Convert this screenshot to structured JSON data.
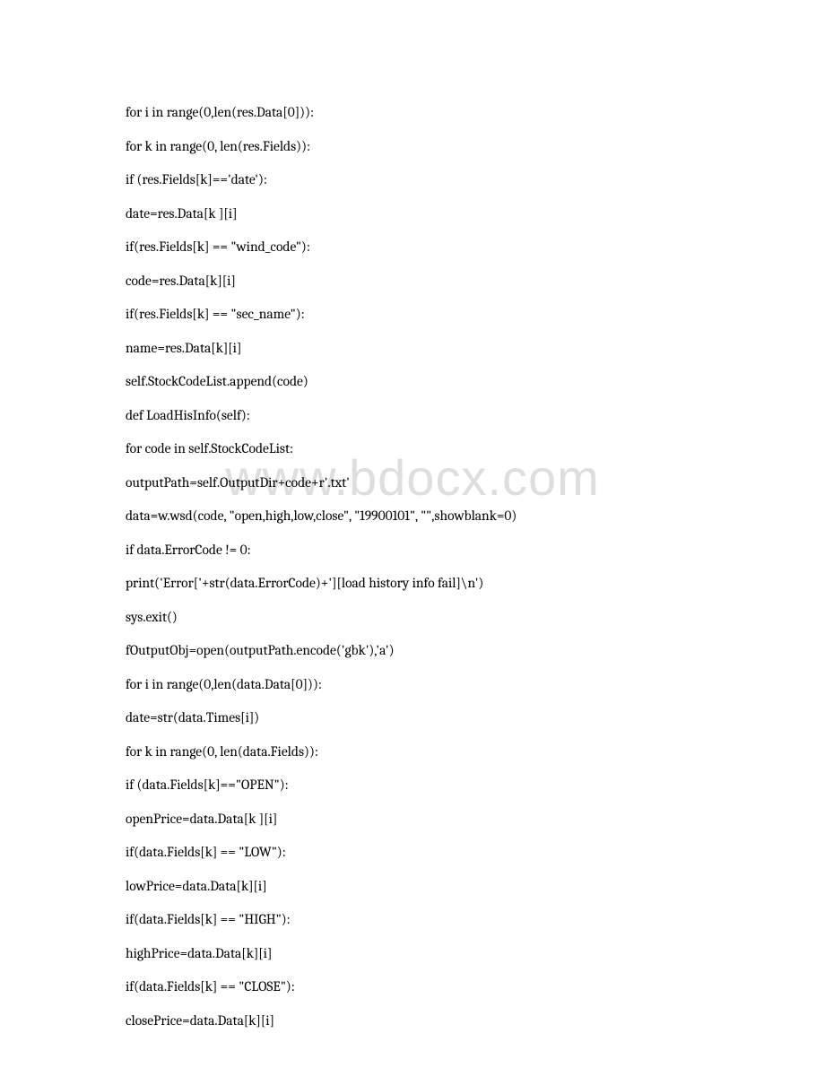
{
  "watermark": "www.bdocx.com",
  "code_lines": [
    "for i in range(0,len(res.Data[0])):",
    "for k in range(0, len(res.Fields)):",
    "if (res.Fields[k]=='date'):",
    "date=res.Data[k ][i]",
    "if(res.Fields[k] == \"wind_code\"):",
    "code=res.Data[k][i]",
    "if(res.Fields[k] == \"sec_name\"):",
    "name=res.Data[k][i]",
    "self.StockCodeList.append(code)",
    "def LoadHisInfo(self):",
    "for code in self.StockCodeList:",
    "outputPath=self.OutputDir+code+r'.txt'",
    "data=w.wsd(code, \"open,high,low,close\", \"19900101\", \"\",showblank=0)",
    "if data.ErrorCode != 0:",
    "print('Error['+str(data.ErrorCode)+'][load history info fail]\\n')",
    "sys.exit()",
    "fOutputObj=open(outputPath.encode('gbk'),'a')",
    "for i in range(0,len(data.Data[0])):",
    "date=str(data.Times[i])",
    "for k in range(0, len(data.Fields)):",
    "if (data.Fields[k]==\"OPEN\"):",
    "openPrice=data.Data[k ][i]",
    "if(data.Fields[k] == \"LOW\"):",
    "lowPrice=data.Data[k][i]",
    "if(data.Fields[k] == \"HIGH\"):",
    "highPrice=data.Data[k][i]",
    "if(data.Fields[k] == \"CLOSE\"):",
    "closePrice=data.Data[k][i]"
  ]
}
